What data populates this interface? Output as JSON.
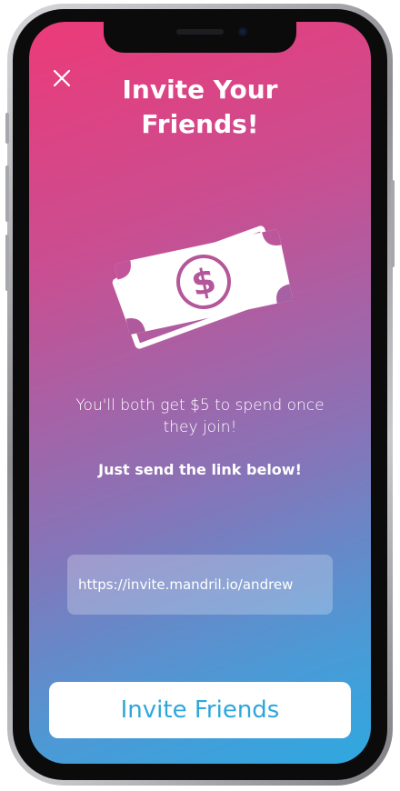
{
  "screen": {
    "title": "Invite Your Friends!",
    "subtitle": "You'll both get $5 to spend once they join!",
    "instruction": "Just send the link below!",
    "link": "https://invite.mandril.io/andrew",
    "cta_label": "Invite Friends",
    "icons": {
      "close": "close-icon",
      "illustration": "money-bills-icon",
      "dollar": "dollar-sign"
    },
    "colors": {
      "gradient_top": "#ec3a78",
      "gradient_mid": "#8a72b6",
      "gradient_bottom": "#2fa8e0",
      "cta_text": "#2ea6dc",
      "button_bg": "#ffffff"
    }
  }
}
